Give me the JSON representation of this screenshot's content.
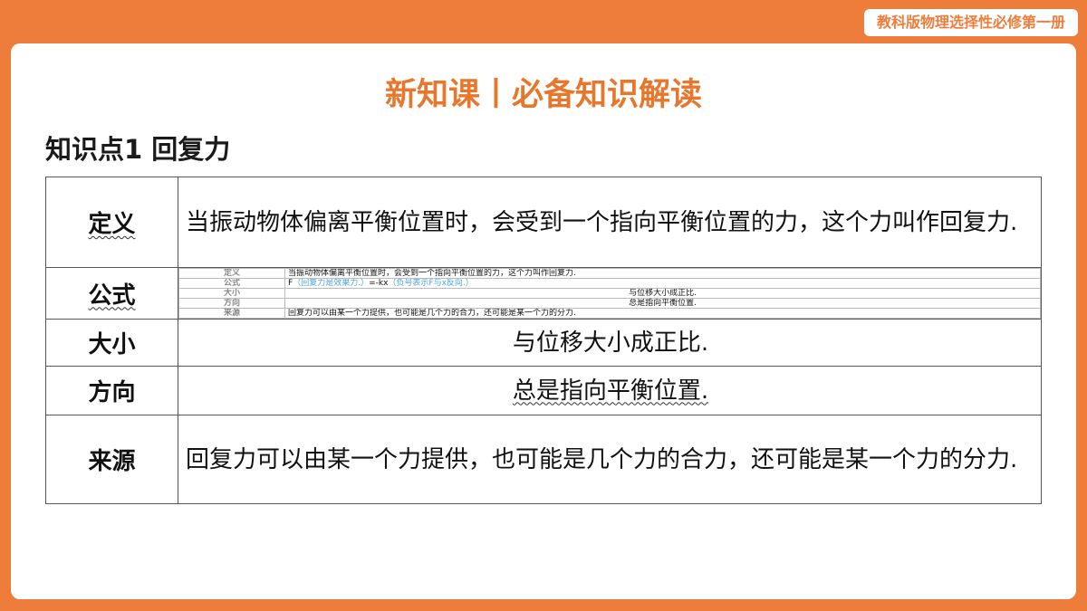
{
  "header": {
    "book_tag": "教科版物理选择性必修第一册"
  },
  "slide": {
    "title": "新知课丨必备知识解读",
    "point_heading": "知识点1  回复力"
  },
  "table": {
    "rows": [
      {
        "label": "定义",
        "content": "当振动物体偏离平衡位置时，会受到一个指向平衡位置的力，这个力叫作回复力."
      },
      {
        "label": "公式"
      },
      {
        "label": "大小",
        "content": "与位移大小成正比."
      },
      {
        "label": "方向",
        "content": "总是指向平衡位置."
      },
      {
        "label": "来源",
        "content": "回复力可以由某一个力提供，也可能是几个力的合力，还可能是某一个力的分力."
      }
    ],
    "formula_inset": {
      "rows": [
        {
          "label": "定义",
          "content": "当振动物体偏离平衡位置时，会受到一个指向平衡位置的力，这个力叫作回复力."
        },
        {
          "label": "公式",
          "content_prefix": "F",
          "content_blue": "（回复力是效果力.）",
          "content_mid": "=-kx",
          "content_blue2": "（负号表示F与x反向.）"
        },
        {
          "label": "大小",
          "content": "与位移大小成正比."
        },
        {
          "label": "方向",
          "content": "总是指向平衡位置."
        },
        {
          "label": "来源",
          "content": "回复力可以由某一个力提供，也可能是几个力的合力，还可能是某一个力的分力."
        }
      ]
    }
  },
  "colors": {
    "frame": "#ee7d3b",
    "title": "#e8772e"
  }
}
